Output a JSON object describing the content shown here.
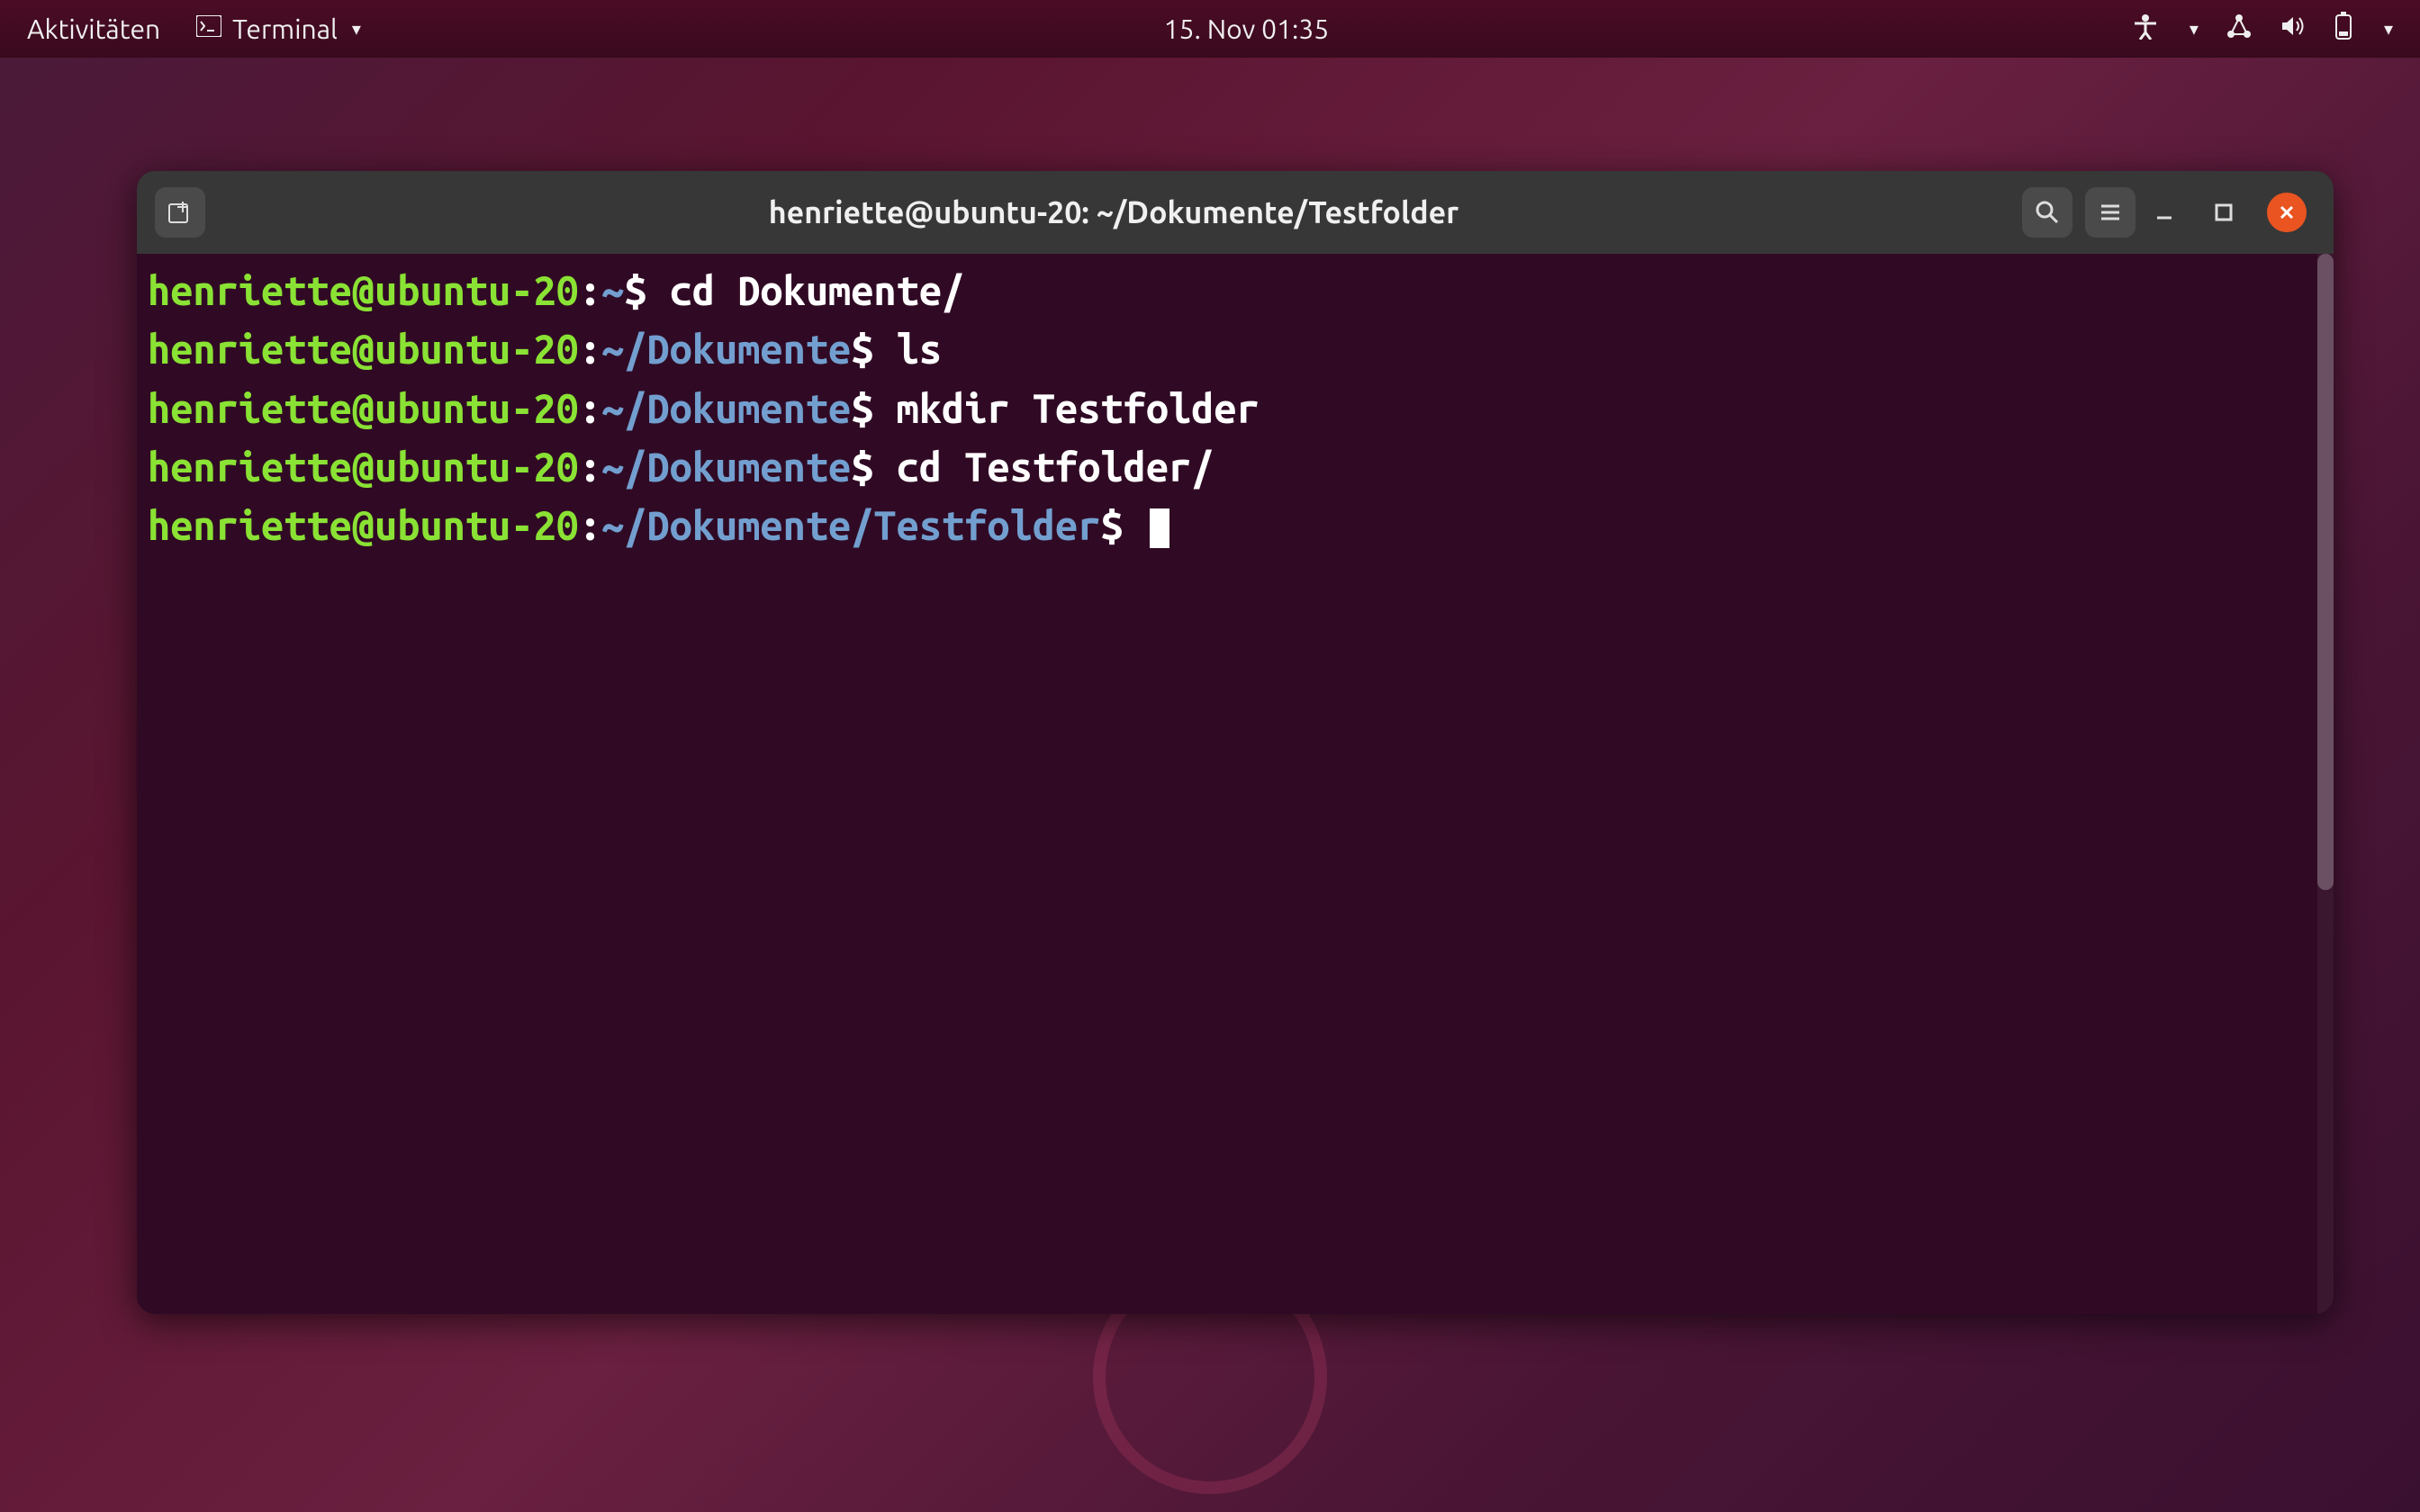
{
  "menubar": {
    "activities": "Aktivitäten",
    "app_name": "Terminal",
    "datetime": "15. Nov  01:35"
  },
  "terminal": {
    "title": "henriette@ubuntu-20: ~/Dokumente/Testfolder",
    "lines": [
      {
        "user_host": "henriette@ubuntu-20",
        "path": "~",
        "cmd": "cd Dokumente/"
      },
      {
        "user_host": "henriette@ubuntu-20",
        "path": "~/Dokumente",
        "cmd": "ls"
      },
      {
        "user_host": "henriette@ubuntu-20",
        "path": "~/Dokumente",
        "cmd": "mkdir Testfolder"
      },
      {
        "user_host": "henriette@ubuntu-20",
        "path": "~/Dokumente",
        "cmd": "cd Testfolder/"
      },
      {
        "user_host": "henriette@ubuntu-20",
        "path": "~/Dokumente/Testfolder",
        "cmd": ""
      }
    ],
    "prompt_sep": ":",
    "prompt_char": "$"
  }
}
